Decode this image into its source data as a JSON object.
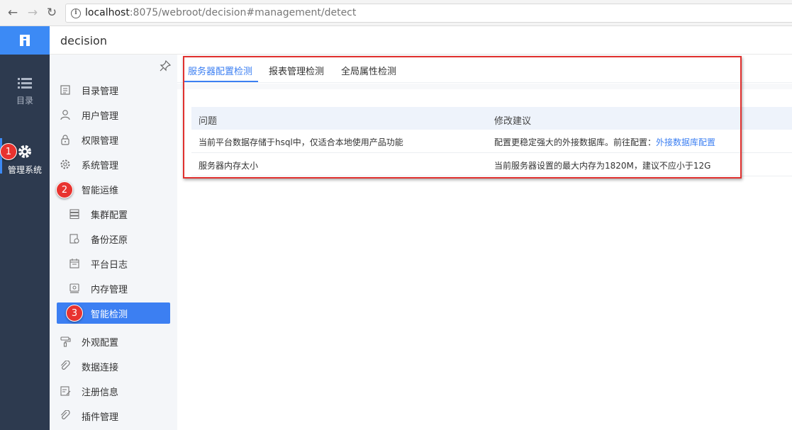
{
  "browser": {
    "url_host": "localhost",
    "url_rest": ":8075/webroot/decision#management/detect"
  },
  "rail": {
    "items": [
      {
        "label": "目录",
        "icon": "list-icon"
      },
      {
        "label": "管理系统",
        "icon": "gear-icon",
        "active": true
      }
    ]
  },
  "header": {
    "title": "decision"
  },
  "sidebar": {
    "items": [
      {
        "label": "目录管理",
        "icon": "catalog-icon"
      },
      {
        "label": "用户管理",
        "icon": "user-icon"
      },
      {
        "label": "权限管理",
        "icon": "lock-icon"
      },
      {
        "label": "系统管理",
        "icon": "gear-icon"
      },
      {
        "label": "智能运维",
        "icon": "ops-icon"
      },
      {
        "label": "集群配置",
        "icon": "server-icon",
        "sub": true
      },
      {
        "label": "备份还原",
        "icon": "backup-icon",
        "sub": true
      },
      {
        "label": "平台日志",
        "icon": "log-icon",
        "sub": true
      },
      {
        "label": "内存管理",
        "icon": "memory-icon",
        "sub": true
      },
      {
        "label": "智能检测",
        "icon": "detect-icon",
        "sub": true,
        "selected": true
      },
      {
        "label": "外观配置",
        "icon": "paint-icon"
      },
      {
        "label": "数据连接",
        "icon": "link-icon"
      },
      {
        "label": "注册信息",
        "icon": "register-icon"
      },
      {
        "label": "插件管理",
        "icon": "plugin-icon"
      }
    ]
  },
  "tabs": [
    {
      "label": "服务器配置检测",
      "active": true
    },
    {
      "label": "报表管理检测"
    },
    {
      "label": "全局属性检测"
    }
  ],
  "table": {
    "headers": [
      "问题",
      "修改建议"
    ],
    "rows": [
      {
        "issue": "当前平台数据存储于hsql中，仅适合本地使用产品功能",
        "suggestion": "配置更稳定强大的外接数据库。前往配置：",
        "link": "外接数据库配置"
      },
      {
        "issue": "服务器内存太小",
        "suggestion": "当前服务器设置的最大内存为1820M，建议不应小于12G"
      }
    ]
  },
  "annotations": [
    "1",
    "2",
    "3"
  ],
  "colors": {
    "accent": "#3c7ff2",
    "rail_bg": "#2d3a4f",
    "annotation_red": "#e0302e"
  }
}
